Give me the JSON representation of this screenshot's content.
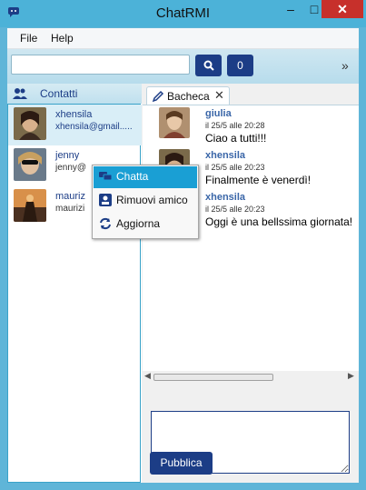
{
  "window": {
    "title": "ChatRMI",
    "minimize": "–",
    "maximize": "□",
    "close": "✕"
  },
  "menu": {
    "items": [
      "File",
      "Help"
    ]
  },
  "toolbar": {
    "search_value": "",
    "friend_requests_count": "0",
    "collapse": "»"
  },
  "contacts": {
    "title": "Contatti",
    "items": [
      {
        "name": "xhensila",
        "email": "xhensila@gmail....."
      },
      {
        "name": "jenny",
        "email": "jenny@"
      },
      {
        "name": "mauriz",
        "email": "maurizi"
      }
    ]
  },
  "tabs": [
    {
      "label": "Bacheca",
      "close": "✕"
    }
  ],
  "posts": [
    {
      "author": "giulia",
      "time": "il 25/5 alle 20:28",
      "text": "Ciao a tutti!!!"
    },
    {
      "author": "xhensila",
      "time": "il 25/5 alle 20:23",
      "text": "Finalmente è venerdì!"
    },
    {
      "author": "xhensila",
      "time": "il 25/5 alle 20:23",
      "text": "Oggi è una bellssima giornata!"
    }
  ],
  "compose": {
    "value": "",
    "publish_label": "Pubblica"
  },
  "context_menu": {
    "items": [
      {
        "label": "Chatta",
        "icon": "chat-bubbles-icon"
      },
      {
        "label": "Rimuovi amico",
        "icon": "remove-friend-icon"
      },
      {
        "label": "Aggiorna",
        "icon": "refresh-icon"
      }
    ]
  },
  "colors": {
    "accent": "#1c3d86",
    "title_bar": "#4cb2d8",
    "selection": "#1a9fd4",
    "close": "#c7302b"
  }
}
